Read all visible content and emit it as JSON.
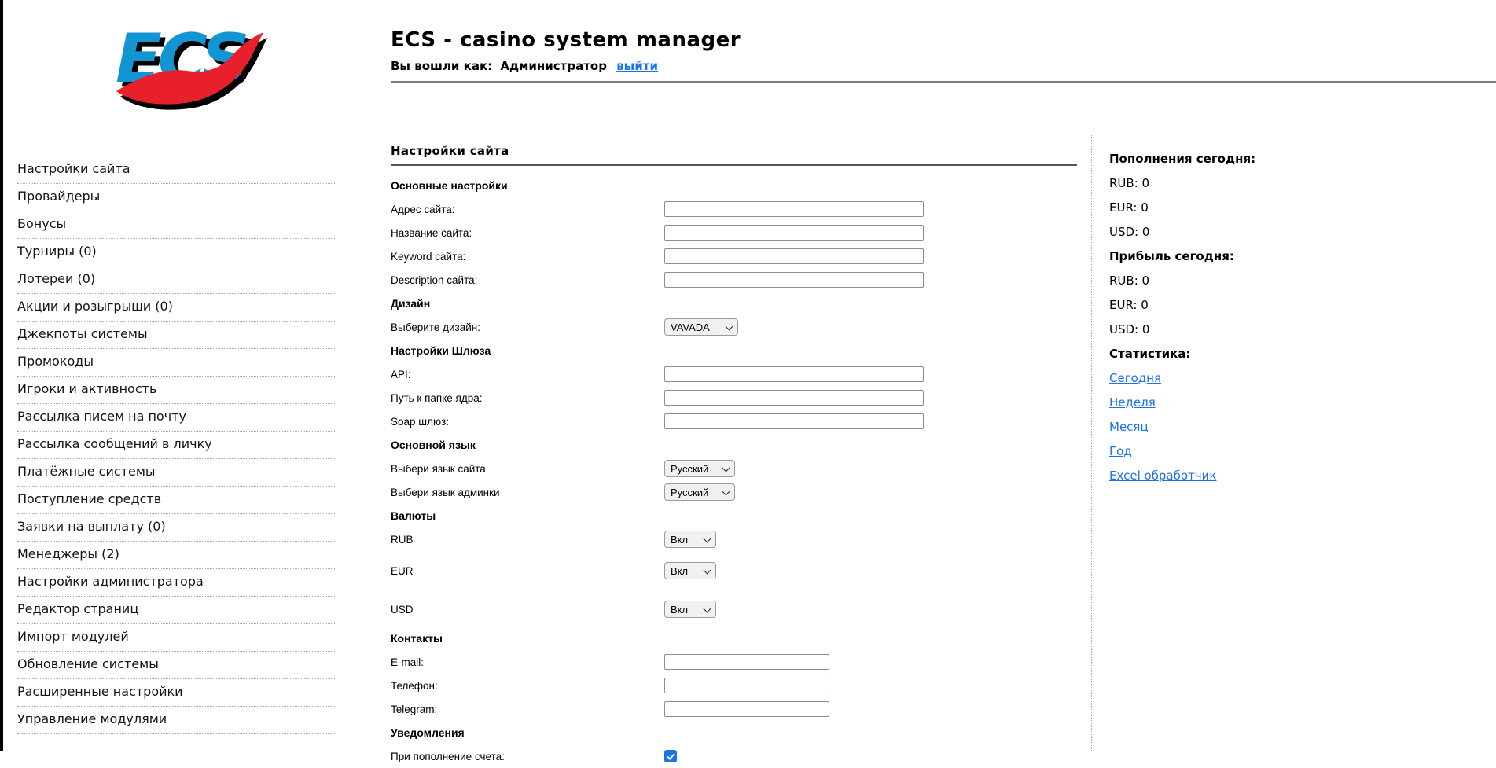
{
  "header": {
    "logo_text": "ECS",
    "title": "ECS - casino system manager",
    "login_prefix": "Вы вошли как:",
    "login_user": "Администратор",
    "logout_label": "выйти"
  },
  "sidebar": {
    "items": [
      "Настройки сайта",
      "Провайдеры",
      "Бонусы",
      "Турниры (0)",
      "Лотереи (0)",
      "Акции и розыгрыши (0)",
      "Джекпоты системы",
      "Промокоды",
      "Игроки и активность",
      "Рассылка писем на почту",
      "Рассылка сообщений в личку",
      "Платёжные системы",
      "Поступление средств",
      "Заявки на выплату (0)",
      "Менеджеры (2)",
      "Настройки администратора",
      "Редактор страниц",
      "Импорт модулей",
      "Обновление системы",
      "Расширенные настройки",
      "Управление модулями"
    ]
  },
  "main": {
    "title": "Настройки сайта",
    "rows": [
      {
        "type": "section",
        "label": "Основные настройки"
      },
      {
        "type": "text",
        "name": "site-address",
        "label": "Адрес сайта:",
        "value": "",
        "placeholder": "",
        "size": "long"
      },
      {
        "type": "text",
        "name": "site-name",
        "label": "Название сайта:",
        "value": "",
        "placeholder": "",
        "size": "long"
      },
      {
        "type": "text",
        "name": "site-keyword",
        "label": "Keyword сайта:",
        "value": "",
        "placeholder": "",
        "size": "long"
      },
      {
        "type": "text",
        "name": "site-description",
        "label": "Description сайта:",
        "value": "",
        "placeholder": "",
        "size": "long"
      },
      {
        "type": "section",
        "label": "Дизайн"
      },
      {
        "type": "select",
        "name": "design",
        "label": "Выберите дизайн:",
        "value": "VAVADA",
        "size": "lg"
      },
      {
        "type": "section",
        "label": "Настройки Шлюза"
      },
      {
        "type": "text",
        "name": "api",
        "label": "API:",
        "value": "",
        "placeholder": "",
        "size": "long"
      },
      {
        "type": "text",
        "name": "core-folder-path",
        "label": "Путь к папке ядра:",
        "value": "",
        "placeholder": "",
        "size": "long"
      },
      {
        "type": "text",
        "name": "soap-gateway",
        "label": "Soap шлюз:",
        "value": "",
        "placeholder": "",
        "size": "long"
      },
      {
        "type": "section",
        "label": "Основной язык"
      },
      {
        "type": "select",
        "name": "site-language",
        "label": "Выбери язык сайта",
        "value": "Русский",
        "size": "md"
      },
      {
        "type": "select",
        "name": "admin-language",
        "label": "Выбери язык админки",
        "value": "Русский",
        "size": "md"
      },
      {
        "type": "section",
        "label": "Валюты"
      },
      {
        "type": "select",
        "name": "currency-rub",
        "label": "RUB",
        "value": "Вкл",
        "size": "sm",
        "gap": "gap-rub"
      },
      {
        "type": "select",
        "name": "currency-eur",
        "label": "EUR",
        "value": "Вкл",
        "size": "sm",
        "gap": "gap-eur"
      },
      {
        "type": "select",
        "name": "currency-usd",
        "label": "USD",
        "value": "Вкл",
        "size": "sm",
        "gap": "gap-usd"
      },
      {
        "type": "section",
        "label": "Контакты"
      },
      {
        "type": "text",
        "name": "email",
        "label": "E-mail:",
        "value": "",
        "placeholder": "",
        "size": "short"
      },
      {
        "type": "text",
        "name": "phone",
        "label": "Телефон:",
        "value": "",
        "placeholder": "",
        "size": "short"
      },
      {
        "type": "text",
        "name": "telegram",
        "label": "Telegram:",
        "value": "",
        "placeholder": "",
        "size": "short"
      },
      {
        "type": "section",
        "label": "Уведомления"
      },
      {
        "type": "checkbox",
        "name": "notify-on-deposit",
        "label": "При пополнение счета:",
        "checked": true
      }
    ]
  },
  "right_panel": {
    "lines": [
      {
        "type": "title",
        "text": "Пополнения сегодня:"
      },
      {
        "type": "text",
        "text": "RUB: 0"
      },
      {
        "type": "text",
        "text": "EUR: 0"
      },
      {
        "type": "text",
        "text": "USD: 0"
      },
      {
        "type": "title",
        "text": "Прибыль сегодня:"
      },
      {
        "type": "text",
        "text": "RUB: 0"
      },
      {
        "type": "text",
        "text": "EUR: 0"
      },
      {
        "type": "text",
        "text": "USD: 0"
      },
      {
        "type": "title",
        "text": "Статистика:"
      },
      {
        "type": "link",
        "text": "Сегодня"
      },
      {
        "type": "link",
        "text": "Неделя"
      },
      {
        "type": "link",
        "text": "Месяц"
      },
      {
        "type": "link",
        "text": "Год"
      },
      {
        "type": "link",
        "text": "Excel обработчик"
      }
    ]
  },
  "colors": {
    "link_blue": "#1a73e8",
    "checkbox_blue": "#1a73e8",
    "logo_blue": "#1495d3",
    "logo_red": "#e8202b",
    "rule_gray": "#7c7c7c",
    "dotted_gray": "#ababab"
  }
}
